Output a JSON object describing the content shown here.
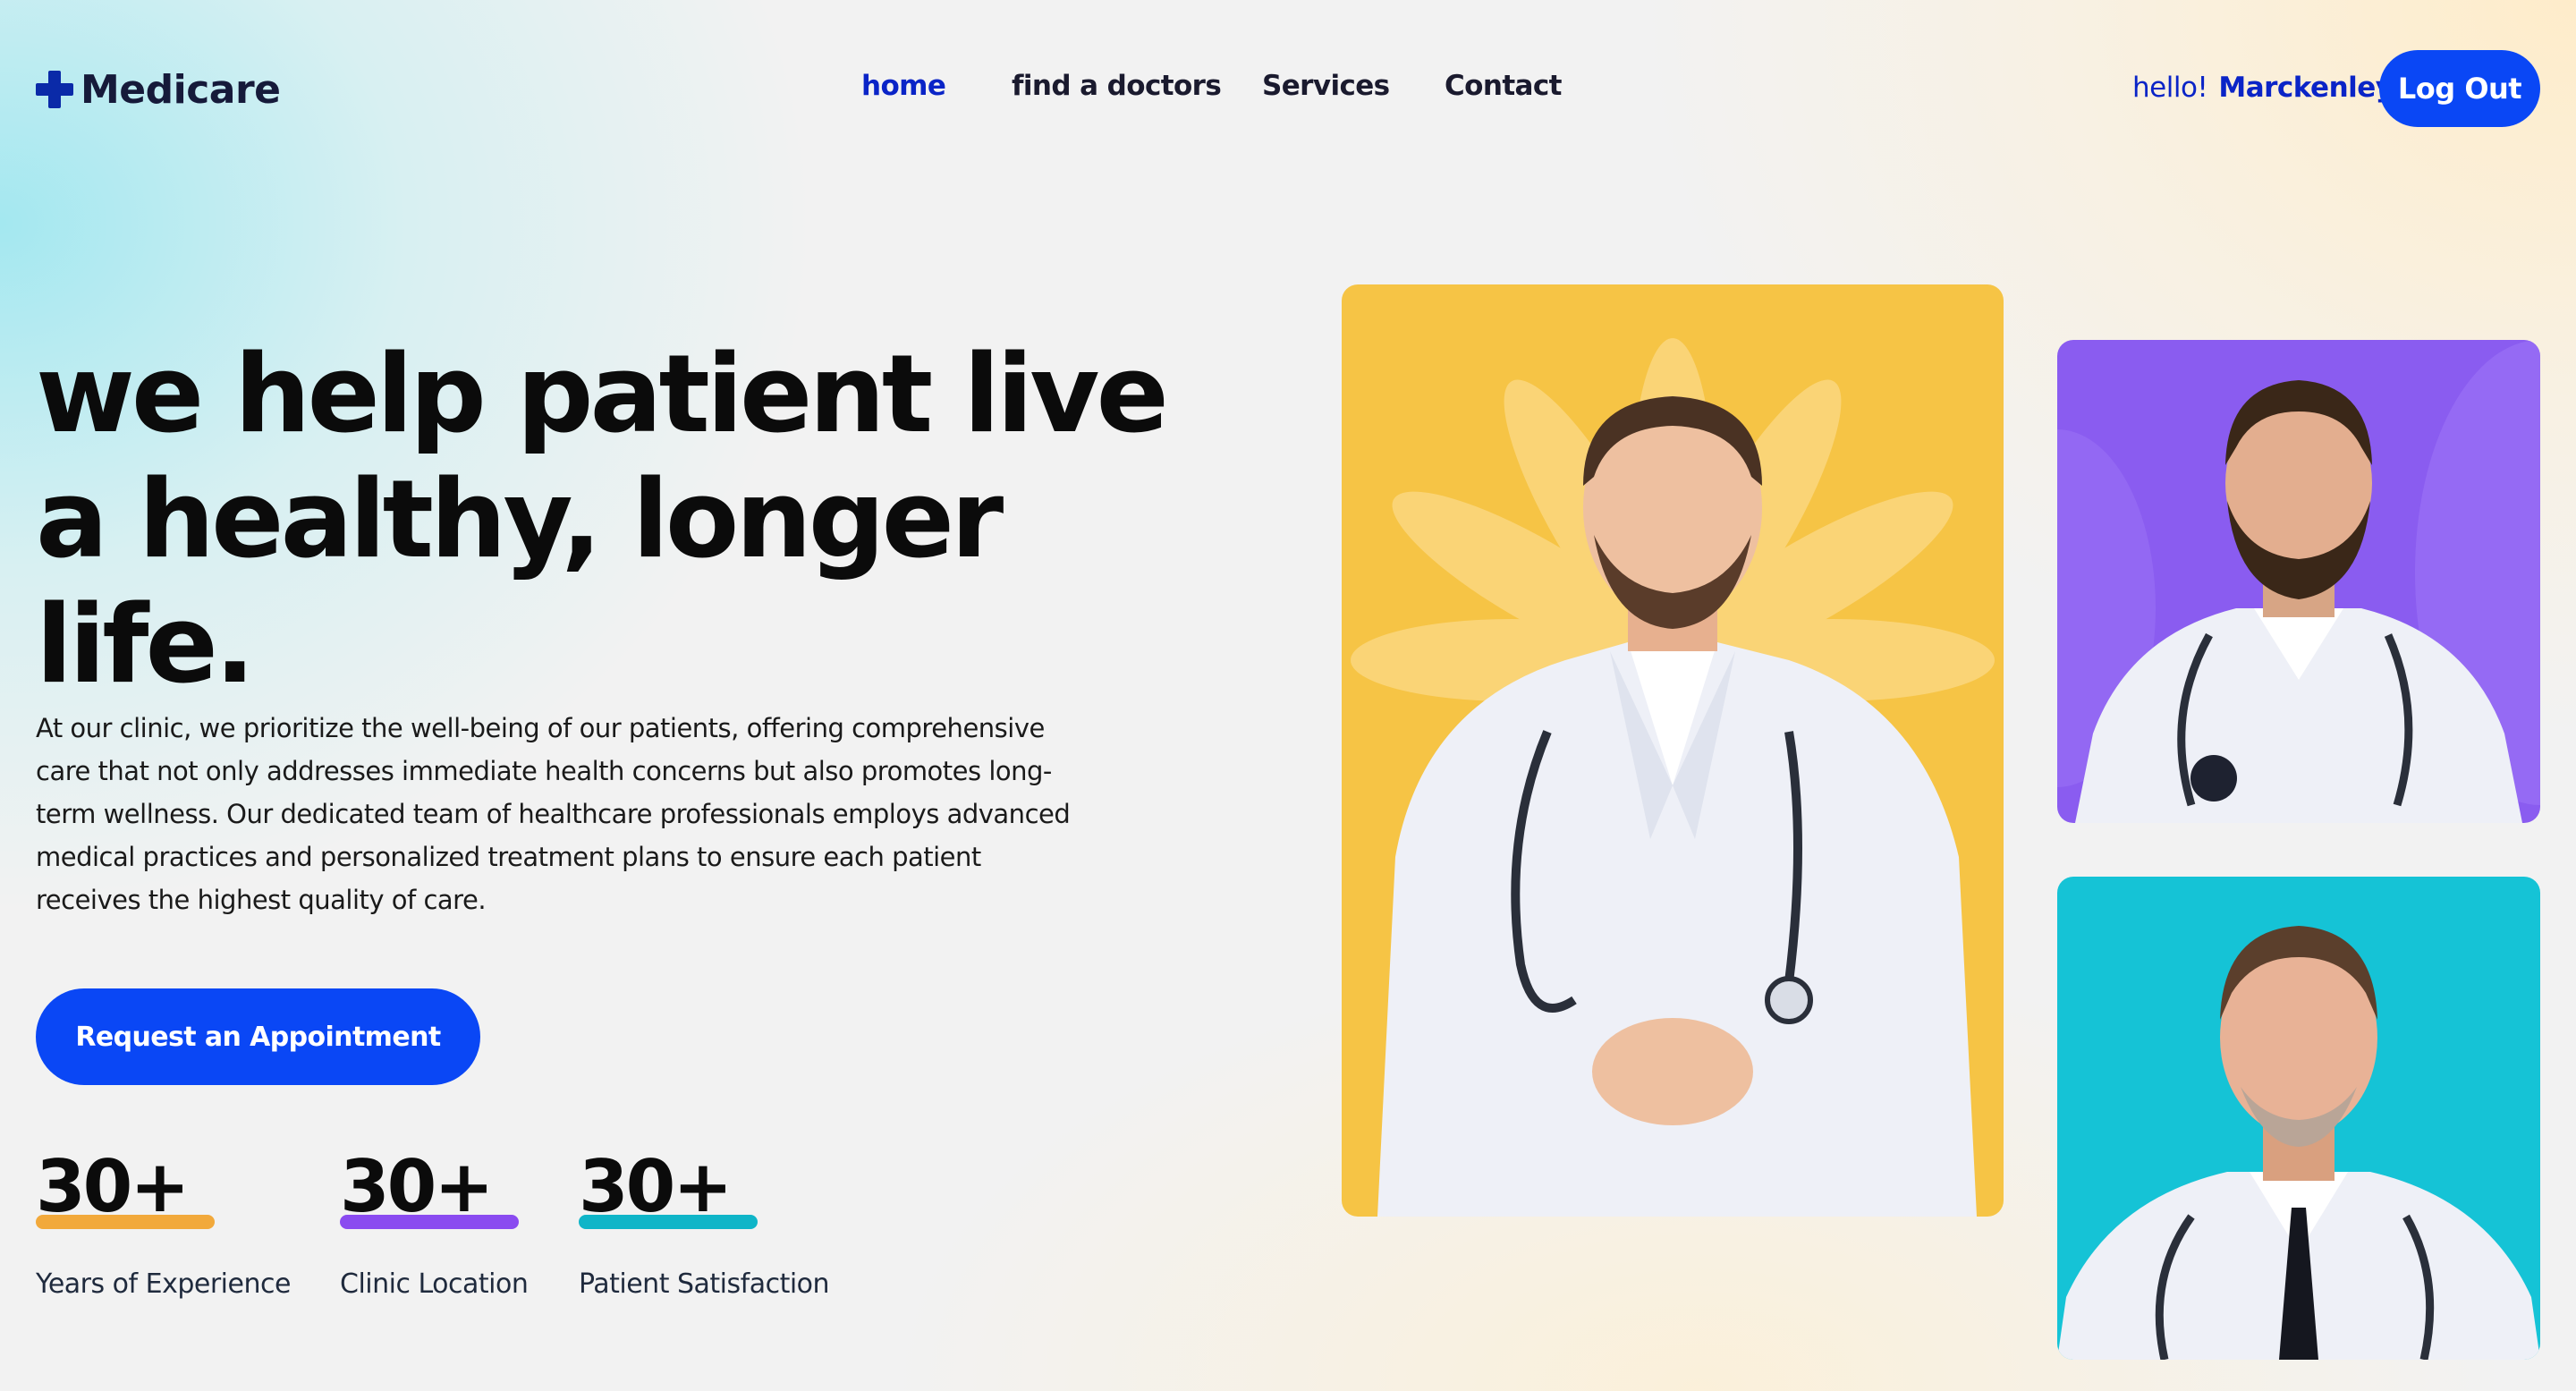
{
  "brand": {
    "name": "Medicare",
    "colors": {
      "primary": "#0a47f5",
      "nav_active": "#0a24c7"
    }
  },
  "nav": {
    "items": [
      {
        "label": "home",
        "active": true
      },
      {
        "label": "find a doctors",
        "active": false
      },
      {
        "label": "Services",
        "active": false
      },
      {
        "label": "Contact",
        "active": false
      }
    ]
  },
  "user": {
    "greeting": "hello!",
    "name": "Marckenley",
    "logout_label": "Log Out"
  },
  "hero": {
    "headline_lines": [
      "we help patient live",
      "a healthy, longer",
      "life."
    ],
    "description": "At our clinic, we prioritize the well-being of our patients, offering comprehensive care that not only addresses immediate health concerns but also promotes long-term wellness. Our dedicated team of healthcare professionals employs advanced medical practices and personalized treatment plans to ensure each patient receives the highest quality of care.",
    "cta_label": "Request an Appointment"
  },
  "stats": [
    {
      "value": "30+",
      "label": "Years of Experience",
      "accent": "#f2a93b"
    },
    {
      "value": "30+",
      "label": "Clinic Location",
      "accent": "#8a4bf0"
    },
    {
      "value": "30+",
      "label": "Patient Satisfaction",
      "accent": "#0fb5c8"
    }
  ],
  "doctor_cards": [
    {
      "background": "#f6c445"
    },
    {
      "background": "#8a5cf0"
    },
    {
      "background": "#15c3d6"
    }
  ]
}
